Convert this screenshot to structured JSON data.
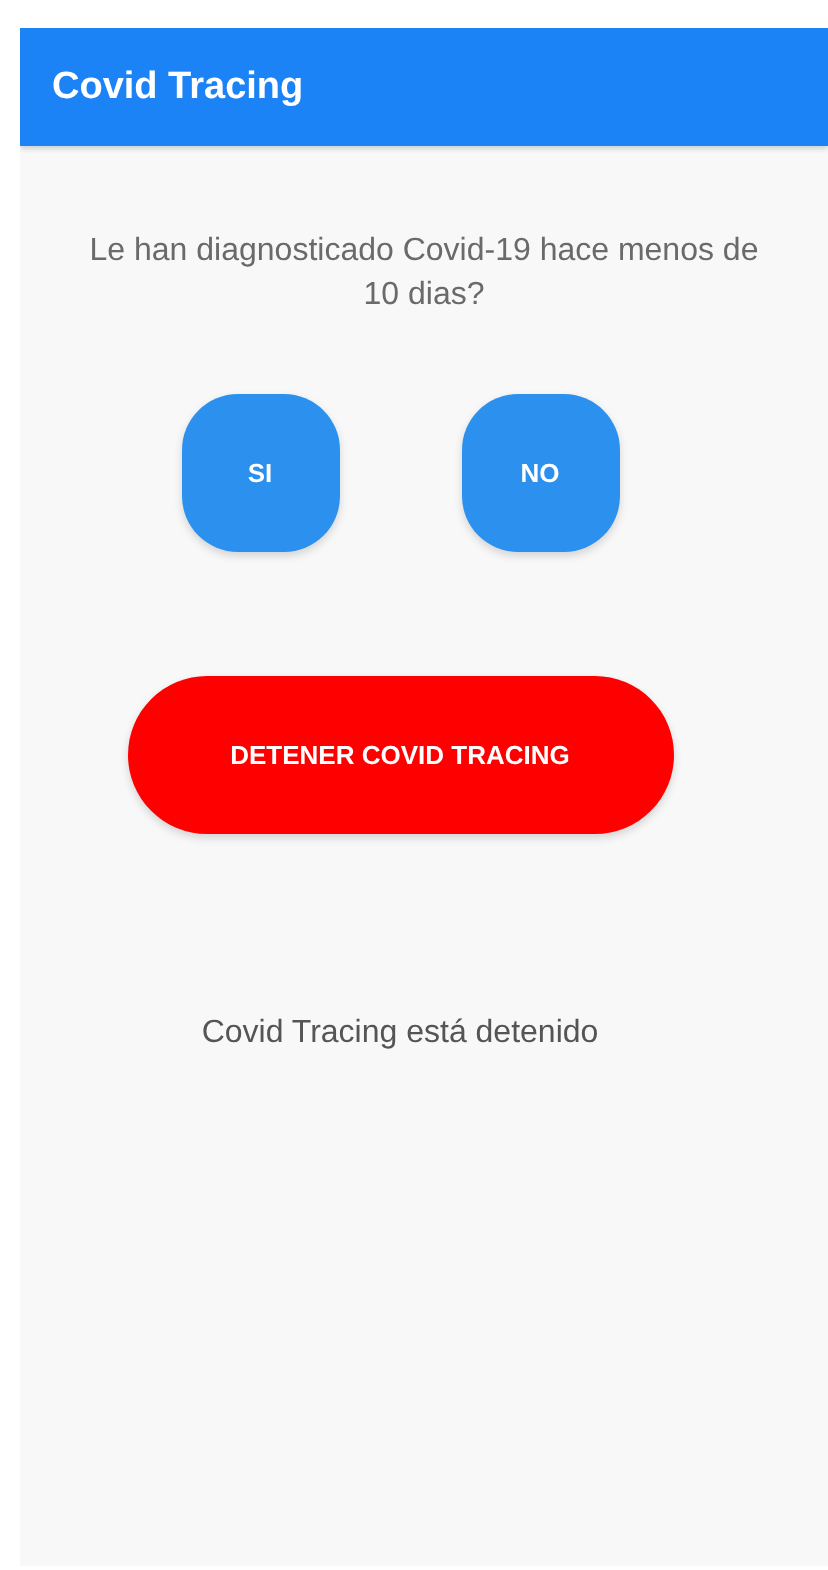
{
  "app_bar": {
    "title": "Covid Tracing"
  },
  "question": {
    "lines": [
      "Le han diagnosticado Covid-19 hace menos de",
      "10 dias?"
    ]
  },
  "answers": [
    {
      "label": "SI"
    },
    {
      "label": "NO"
    }
  ],
  "action_button": {
    "label": "DETENER COVID TRACING"
  },
  "status": "Covid Tracing está detenido"
}
